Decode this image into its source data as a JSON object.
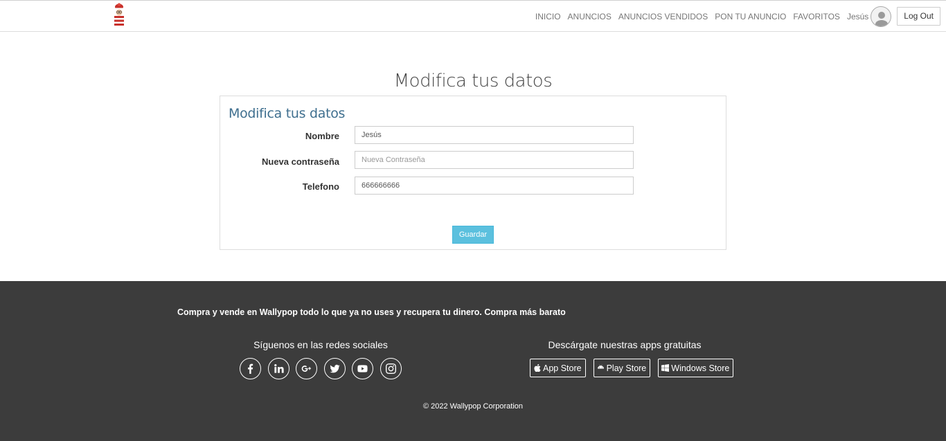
{
  "navbar": {
    "links": [
      "INICIO",
      "ANUNCIOS",
      "ANUNCIOS VENDIDOS",
      "PON TU ANUNCIO",
      "FAVORITOS"
    ],
    "user_name": "Jesús",
    "logout_label": "Log Out"
  },
  "page": {
    "title": "Modifica tus datos"
  },
  "form": {
    "title": "Modifica tus datos",
    "nombre_label": "Nombre",
    "nombre_value": "Jesús",
    "password_label": "Nueva contraseña",
    "password_placeholder": "Nueva Contraseña",
    "telefono_label": "Telefono",
    "telefono_value": "666666666",
    "save_label": "Guardar"
  },
  "footer": {
    "tagline": "Compra y vende en Wallypop todo lo que ya no uses y recupera tu dinero. Compra más barato",
    "social_heading": "Síguenos en las redes sociales",
    "social_icons": [
      "facebook-icon",
      "linkedin-icon",
      "google-plus-icon",
      "twitter-icon",
      "youtube-icon",
      "instagram-icon"
    ],
    "apps_heading": "Descárgate nuestras apps gratuitas",
    "stores": [
      "App Store",
      "Play Store",
      "Windows Store"
    ],
    "copyright": "© 2022 Wallypop Corporation"
  },
  "colors": {
    "footer_bg": "#3c3c3c",
    "save_button": "#5bc0de",
    "panel_title": "#3f6f8f"
  }
}
